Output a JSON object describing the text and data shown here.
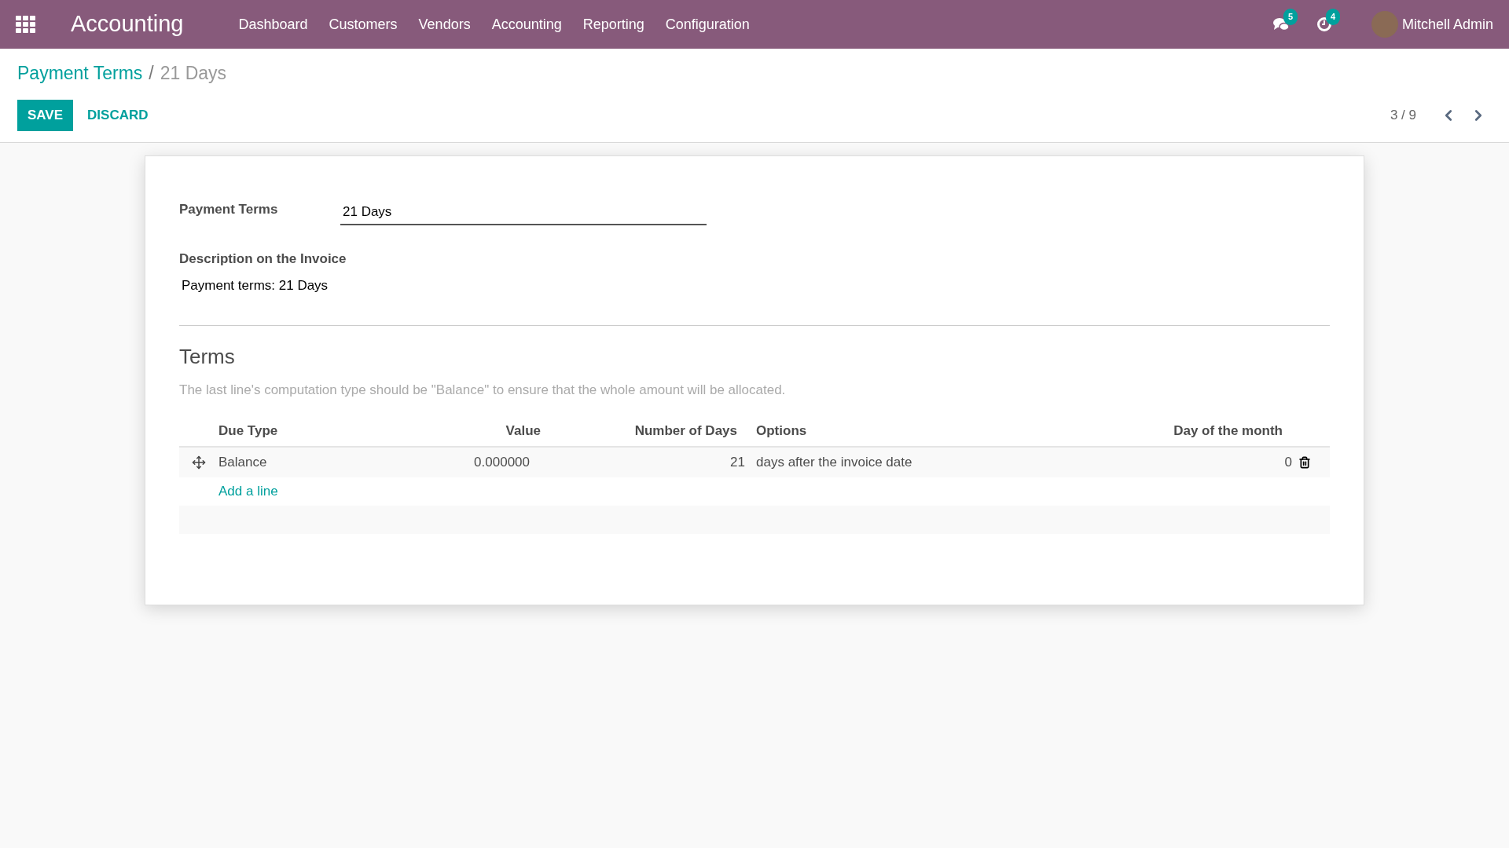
{
  "navbar": {
    "app_title": "Accounting",
    "menu": [
      {
        "label": "Dashboard"
      },
      {
        "label": "Customers"
      },
      {
        "label": "Vendors"
      },
      {
        "label": "Accounting"
      },
      {
        "label": "Reporting"
      },
      {
        "label": "Configuration"
      }
    ],
    "messages_count": "5",
    "activities_count": "4",
    "user": "Mitchell Admin"
  },
  "breadcrumb": {
    "parent": "Payment Terms",
    "separator": "/",
    "current": "21 Days"
  },
  "actions": {
    "save": "SAVE",
    "discard": "DISCARD"
  },
  "pager": {
    "text": "3 / 9"
  },
  "form": {
    "name_label": "Payment Terms",
    "name_value": "21 Days",
    "description_label": "Description on the Invoice",
    "description_value": "Payment terms: 21 Days"
  },
  "terms": {
    "title": "Terms",
    "hint": "The last line's computation type should be \"Balance\" to ensure that the whole amount will be allocated.",
    "columns": [
      "Due Type",
      "Value",
      "Number of Days",
      "Options",
      "Day of the month"
    ],
    "rows": [
      {
        "due_type": "Balance",
        "value": "0.000000",
        "days": "21",
        "option": "days after the invoice date",
        "day_of_month": "0"
      }
    ],
    "add_line": "Add a line"
  }
}
